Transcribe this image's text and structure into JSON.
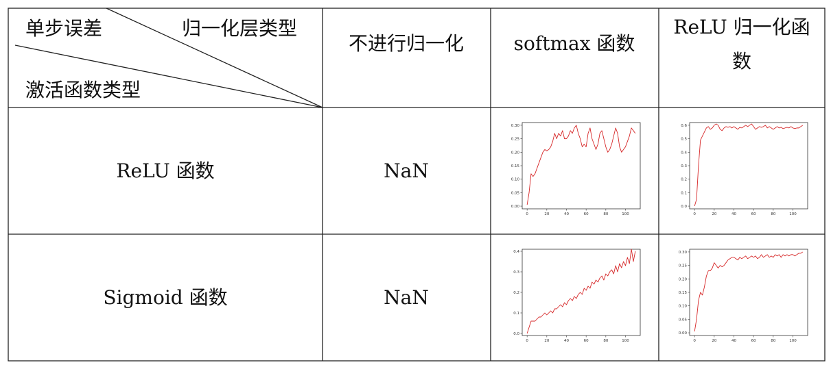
{
  "table": {
    "header": {
      "diag_top_left": "单步误差",
      "diag_top_right": "归一化层类型",
      "diag_bottom": "激活函数类型",
      "col1": "不进行归一化",
      "col2": "softmax 函数",
      "col3_line1": "ReLU 归一化函",
      "col3_line2": "数"
    },
    "rows": [
      {
        "label": "ReLU 函数",
        "col1": "NaN"
      },
      {
        "label": "Sigmoid 函数",
        "col1": "NaN"
      }
    ]
  },
  "chart_data": [
    {
      "id": "relu-softmax",
      "type": "line",
      "color": "#d62728",
      "xlim": [
        -5,
        115
      ],
      "ylim": [
        -0.01,
        0.31
      ],
      "xticks": [
        "0",
        "20",
        "40",
        "60",
        "80",
        "100"
      ],
      "yticks": [
        "0.00",
        "0.05",
        "0.10",
        "0.15",
        "0.20",
        "0.25",
        "0.30"
      ],
      "x": [
        0,
        2,
        4,
        6,
        8,
        10,
        12,
        14,
        16,
        18,
        20,
        22,
        24,
        26,
        28,
        30,
        32,
        34,
        36,
        38,
        40,
        42,
        44,
        46,
        48,
        50,
        52,
        54,
        56,
        58,
        60,
        62,
        64,
        66,
        68,
        70,
        72,
        74,
        76,
        78,
        80,
        82,
        84,
        86,
        88,
        90,
        92,
        94,
        96,
        98,
        100,
        102,
        104,
        106,
        108,
        110
      ],
      "y": [
        0.005,
        0.05,
        0.12,
        0.11,
        0.12,
        0.14,
        0.16,
        0.18,
        0.2,
        0.21,
        0.205,
        0.21,
        0.22,
        0.24,
        0.27,
        0.25,
        0.27,
        0.26,
        0.28,
        0.25,
        0.25,
        0.26,
        0.28,
        0.27,
        0.29,
        0.3,
        0.27,
        0.25,
        0.22,
        0.23,
        0.22,
        0.27,
        0.29,
        0.25,
        0.23,
        0.21,
        0.23,
        0.27,
        0.28,
        0.25,
        0.22,
        0.2,
        0.21,
        0.23,
        0.26,
        0.29,
        0.27,
        0.22,
        0.2,
        0.21,
        0.22,
        0.24,
        0.26,
        0.29,
        0.28,
        0.27
      ]
    },
    {
      "id": "relu-relu",
      "type": "line",
      "color": "#d62728",
      "xlim": [
        -5,
        115
      ],
      "ylim": [
        -0.02,
        0.62
      ],
      "xticks": [
        "0",
        "20",
        "40",
        "60",
        "80",
        "100"
      ],
      "yticks": [
        "0.0",
        "0.1",
        "0.2",
        "0.3",
        "0.4",
        "0.5",
        "0.6"
      ],
      "x": [
        0,
        2,
        4,
        6,
        8,
        10,
        12,
        14,
        16,
        18,
        20,
        22,
        24,
        26,
        28,
        30,
        32,
        34,
        36,
        38,
        40,
        42,
        44,
        46,
        48,
        50,
        52,
        54,
        56,
        58,
        60,
        62,
        64,
        66,
        68,
        70,
        72,
        74,
        76,
        78,
        80,
        82,
        84,
        86,
        88,
        90,
        92,
        94,
        96,
        98,
        100,
        102,
        104,
        106,
        108,
        110
      ],
      "y": [
        0.0,
        0.05,
        0.3,
        0.49,
        0.52,
        0.55,
        0.58,
        0.59,
        0.57,
        0.58,
        0.6,
        0.61,
        0.6,
        0.57,
        0.56,
        0.58,
        0.59,
        0.585,
        0.59,
        0.58,
        0.59,
        0.58,
        0.57,
        0.585,
        0.58,
        0.59,
        0.6,
        0.59,
        0.6,
        0.61,
        0.59,
        0.57,
        0.58,
        0.59,
        0.585,
        0.59,
        0.6,
        0.58,
        0.59,
        0.58,
        0.57,
        0.58,
        0.59,
        0.58,
        0.585,
        0.575,
        0.58,
        0.585,
        0.58,
        0.59,
        0.58,
        0.575,
        0.58,
        0.58,
        0.59,
        0.6
      ]
    },
    {
      "id": "sigmoid-softmax",
      "type": "line",
      "color": "#d62728",
      "xlim": [
        -5,
        115
      ],
      "ylim": [
        -0.01,
        0.41
      ],
      "xticks": [
        "0",
        "20",
        "40",
        "60",
        "80",
        "100"
      ],
      "yticks": [
        "0.0",
        "0.1",
        "0.2",
        "0.3",
        "0.4"
      ],
      "x": [
        0,
        2,
        4,
        6,
        8,
        10,
        12,
        14,
        16,
        18,
        20,
        22,
        24,
        26,
        28,
        30,
        32,
        34,
        36,
        38,
        40,
        42,
        44,
        46,
        48,
        50,
        52,
        54,
        56,
        58,
        60,
        62,
        64,
        66,
        68,
        70,
        72,
        74,
        76,
        78,
        80,
        82,
        84,
        86,
        88,
        90,
        92,
        94,
        96,
        98,
        100,
        102,
        104,
        106,
        108,
        110
      ],
      "y": [
        0.0,
        0.03,
        0.06,
        0.06,
        0.06,
        0.07,
        0.08,
        0.08,
        0.09,
        0.1,
        0.09,
        0.1,
        0.11,
        0.1,
        0.12,
        0.12,
        0.13,
        0.14,
        0.13,
        0.15,
        0.14,
        0.16,
        0.17,
        0.16,
        0.18,
        0.17,
        0.19,
        0.2,
        0.19,
        0.22,
        0.21,
        0.23,
        0.22,
        0.25,
        0.24,
        0.26,
        0.25,
        0.27,
        0.28,
        0.26,
        0.29,
        0.28,
        0.3,
        0.31,
        0.29,
        0.33,
        0.3,
        0.34,
        0.32,
        0.35,
        0.33,
        0.37,
        0.34,
        0.41,
        0.35,
        0.4
      ]
    },
    {
      "id": "sigmoid-relu",
      "type": "line",
      "color": "#d62728",
      "xlim": [
        -5,
        115
      ],
      "ylim": [
        -0.01,
        0.31
      ],
      "xticks": [
        "0",
        "20",
        "40",
        "60",
        "80",
        "100"
      ],
      "yticks": [
        "0.00",
        "0.05",
        "0.10",
        "0.15",
        "0.20",
        "0.25",
        "0.30"
      ],
      "x": [
        0,
        2,
        4,
        6,
        8,
        10,
        12,
        14,
        16,
        18,
        20,
        22,
        24,
        26,
        28,
        30,
        32,
        34,
        36,
        38,
        40,
        42,
        44,
        46,
        48,
        50,
        52,
        54,
        56,
        58,
        60,
        62,
        64,
        66,
        68,
        70,
        72,
        74,
        76,
        78,
        80,
        82,
        84,
        86,
        88,
        90,
        92,
        94,
        96,
        98,
        100,
        102,
        104,
        106,
        108,
        110
      ],
      "y": [
        0.005,
        0.05,
        0.12,
        0.15,
        0.14,
        0.17,
        0.21,
        0.23,
        0.23,
        0.24,
        0.26,
        0.25,
        0.24,
        0.25,
        0.245,
        0.25,
        0.26,
        0.27,
        0.275,
        0.28,
        0.28,
        0.275,
        0.27,
        0.28,
        0.275,
        0.28,
        0.285,
        0.275,
        0.28,
        0.285,
        0.28,
        0.285,
        0.275,
        0.28,
        0.29,
        0.28,
        0.285,
        0.29,
        0.28,
        0.285,
        0.28,
        0.29,
        0.285,
        0.29,
        0.28,
        0.29,
        0.285,
        0.29,
        0.285,
        0.29,
        0.29,
        0.285,
        0.29,
        0.295,
        0.295,
        0.3
      ]
    }
  ]
}
